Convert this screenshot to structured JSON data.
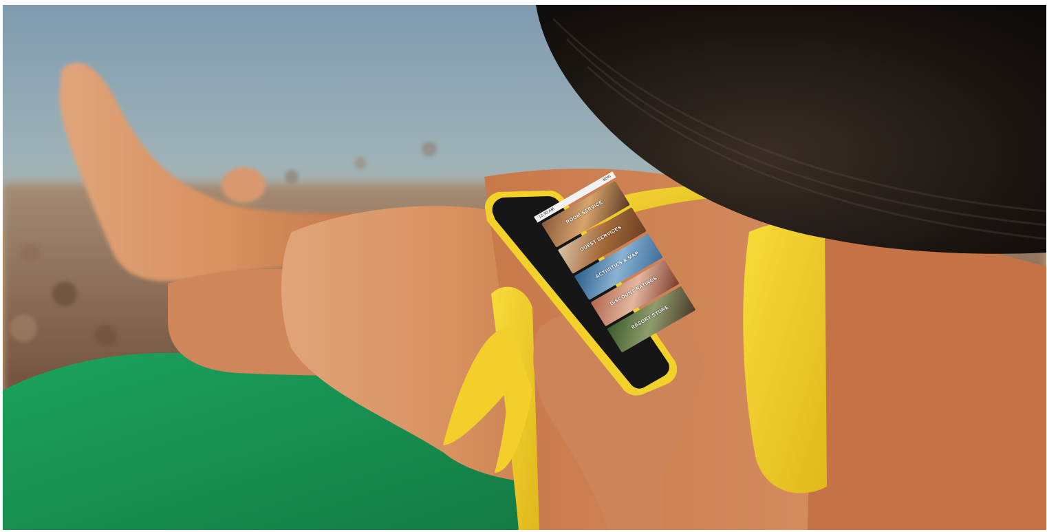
{
  "scene": {
    "description_objects": [
      "sea",
      "pebble-beach",
      "green-towel",
      "woman-in-yellow-bikini",
      "black-sun-hat",
      "smartphone"
    ],
    "colors": {
      "sea": "#8fa9b8",
      "towel": "#1f9a58",
      "bikini": "#f2cf2a",
      "hat": "#1a1512",
      "skin": "#d89366",
      "phone_case": "#f3d12b"
    }
  },
  "phone": {
    "status": {
      "time": "12:30 AM",
      "battery": "80%"
    },
    "menu": [
      {
        "label": "ROOM SERVICE"
      },
      {
        "label": "GUEST SERVICES"
      },
      {
        "label": "ACTIVITIES & MAP"
      },
      {
        "label": "DISCOUNT RATINGS"
      },
      {
        "label": "RESORT STORE"
      }
    ]
  }
}
